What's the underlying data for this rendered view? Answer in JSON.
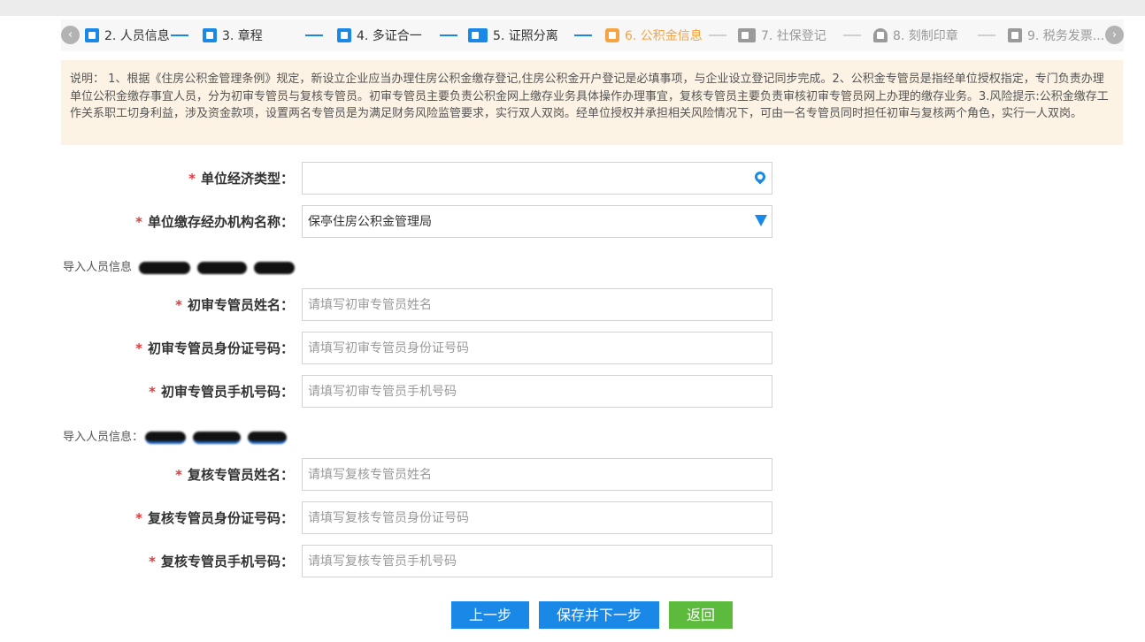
{
  "steps": [
    {
      "label": "2. 人员信息",
      "state": "done",
      "icon": "user-icon"
    },
    {
      "label": "3. 章程",
      "state": "done",
      "icon": "list-icon"
    },
    {
      "label": "4. 多证合一",
      "state": "done",
      "icon": "id-card-icon"
    },
    {
      "label": "5. 证照分离",
      "state": "done",
      "icon": "wallet-card-icon"
    },
    {
      "label": "6. 公积金信息",
      "state": "active",
      "icon": "wallet-icon"
    },
    {
      "label": "7. 社保登记",
      "state": "todo",
      "icon": "contact-card-icon"
    },
    {
      "label": "8. 刻制印章",
      "state": "todo",
      "icon": "stamp-icon"
    },
    {
      "label": "9. 税务发票...",
      "state": "todo",
      "icon": "tax-icon"
    }
  ],
  "nav": {
    "prev": "‹",
    "next": "›"
  },
  "notice": "说明： 1、根据《住房公积金管理条例》规定，新设立企业应当办理住房公积金缴存登记,住房公积金开户登记是必填事项，与企业设立登记同步完成。2、公积金专管员是指经单位授权指定，专门负责办理单位公积金缴存事宜人员，分为初审专管员与复核专管员。初审专管员主要负责公积金网上缴存业务具体操作办理事宜，复核专管员主要负责审核初审专管员网上办理的缴存业务。3.风险提示:公积金缴存工作关系职工切身利益，涉及资金款项，设置两名专管员是为满足财务风险监管要求，实行双人双岗。经单位授权并承担相关风险情况下，可由一名专管员同时担任初审与复核两个角色，实行一人双岗。",
  "form": {
    "economic_type": {
      "label": "单位经济类型：",
      "value": ""
    },
    "agency": {
      "label": "单位缴存经办机构名称：",
      "value": "保亭住房公积金管理局"
    },
    "import1": "导入人员信息",
    "import2": "导入人员信息：",
    "initial_name": {
      "label": "初审专管员姓名：",
      "placeholder": "请填写初审专管员姓名"
    },
    "initial_id": {
      "label": "初审专管员身份证号码：",
      "placeholder": "请填写初审专管员身份证号码"
    },
    "initial_phone": {
      "label": "初审专管员手机号码：",
      "placeholder": "请填写初审专管员手机号码"
    },
    "review_name": {
      "label": "复核专管员姓名：",
      "placeholder": "请填写复核专管员姓名"
    },
    "review_id": {
      "label": "复核专管员身份证号码：",
      "placeholder": "请填写复核专管员身份证号码"
    },
    "review_phone": {
      "label": "复核专管员手机号码：",
      "placeholder": "请填写复核专管员手机号码"
    },
    "required_mark": "*"
  },
  "buttons": {
    "prev": "上一步",
    "save_next": "保存并下一步",
    "back": "返回"
  },
  "colors": {
    "primary": "#1a88e6",
    "active_step": "#f5a442",
    "back_button": "#5cbb3d",
    "required": "#e4393c",
    "notice_bg": "#fcf3e5"
  }
}
